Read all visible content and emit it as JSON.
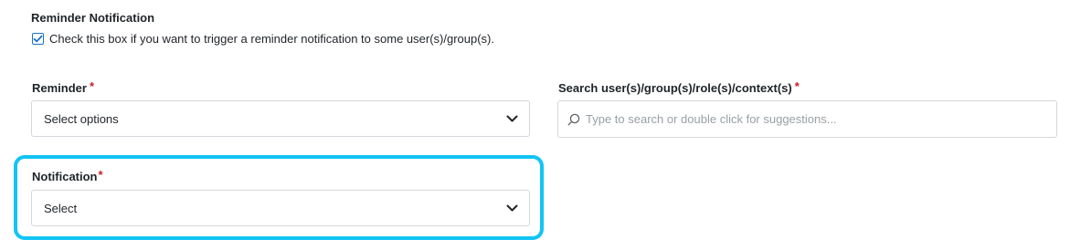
{
  "reminder_section": {
    "title": "Reminder Notification",
    "checkbox_label": "Check this box if you want to trigger a reminder notification to some user(s)/group(s).",
    "checkbox_checked": true
  },
  "reminder_field": {
    "label": "Reminder",
    "required_mark": "*",
    "value": "Select options",
    "icon": "chevron-down-icon"
  },
  "search_field": {
    "label": "Search user(s)/group(s)/role(s)/context(s)",
    "required_mark": "*",
    "placeholder": "Type to search or double click for suggestions...",
    "icon": "search-icon"
  },
  "notification_field": {
    "label": "Notification",
    "required_mark": "*",
    "value": "Select",
    "icon": "chevron-down-icon",
    "highlighted": true
  },
  "colors": {
    "required": "#c81e1e",
    "checkbox": "#1a73c7",
    "highlight": "#12c4f4",
    "border": "#d4d7dc"
  }
}
